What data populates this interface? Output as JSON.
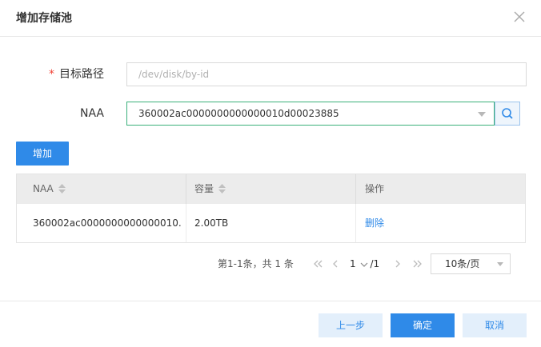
{
  "dialog": {
    "title": "增加存储池"
  },
  "form": {
    "target_path": {
      "required_mark": "*",
      "label": "目标路径",
      "placeholder": "/dev/disk/by-id"
    },
    "naa": {
      "label": "NAA",
      "value": "360002ac0000000000000010d00023885"
    }
  },
  "add_button_label": "增加",
  "table": {
    "columns": [
      {
        "label": "NAA",
        "sortable": true
      },
      {
        "label": "容量",
        "sortable": true
      },
      {
        "label": "操作",
        "sortable": false
      }
    ],
    "rows": [
      {
        "naa": "360002ac0000000000000010...",
        "capacity": "2.00TB",
        "action": "删除"
      }
    ]
  },
  "pagination": {
    "summary": "第1-1条，共 1 条",
    "current_page": "1",
    "total_pages": "/1",
    "page_size": "10条/页"
  },
  "footer": {
    "prev_label": "上一步",
    "confirm_label": "确定",
    "cancel_label": "取消"
  },
  "colors": {
    "primary": "#2f8ae8",
    "focus_border": "#3ab07a",
    "required": "#f04134"
  },
  "icons": [
    "close-icon",
    "search-icon",
    "chevron-down-icon",
    "sort-icon",
    "first-page-icon",
    "prev-page-icon",
    "next-page-icon",
    "last-page-icon"
  ]
}
